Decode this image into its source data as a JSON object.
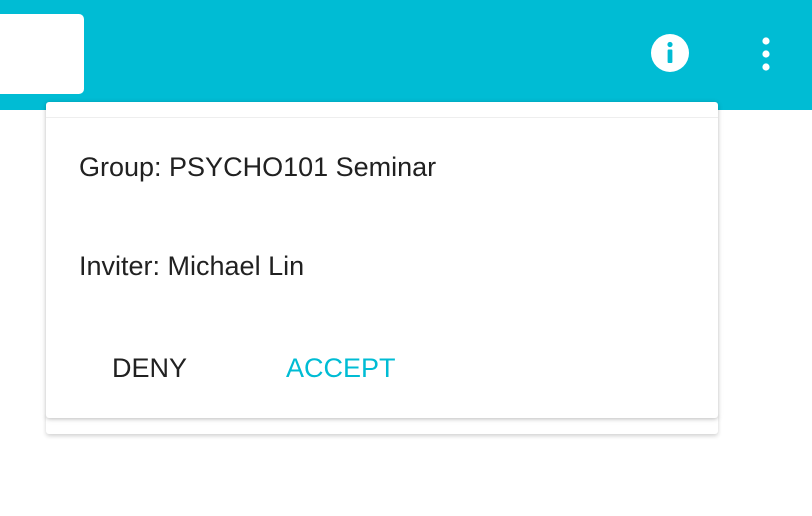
{
  "colors": {
    "header_background": "#00BCD4",
    "accent": "#00BCD4",
    "text_primary": "#212121"
  },
  "header": {
    "icons": {
      "info": "info-icon",
      "more": "more-vertical-icon"
    }
  },
  "invitation": {
    "group_text": "Group: PSYCHO101 Seminar",
    "inviter_text": "Inviter: Michael Lin",
    "deny_label": "DENY",
    "accept_label": "ACCEPT"
  }
}
